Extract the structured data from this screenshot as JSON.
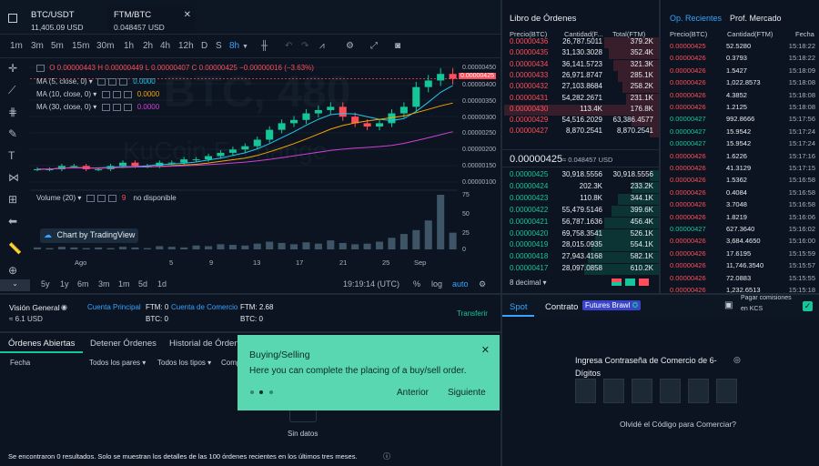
{
  "tabs": [
    {
      "pair": "BTC/USDT",
      "price": "11,405.09 USD"
    },
    {
      "pair": "FTM/BTC",
      "price": "0.048457 USD"
    }
  ],
  "timeframes": [
    "1m",
    "3m",
    "5m",
    "15m",
    "30m",
    "1h",
    "2h",
    "4h",
    "12h",
    "D",
    "S",
    "8h"
  ],
  "ohlc": {
    "o": "O 0.00000443",
    "h": "H 0.00000449",
    "l": "L 0.00000407",
    "c": "C 0.00000425",
    "chg": "−0.00000016 (−3.63%)"
  },
  "ma": [
    {
      "label": "MA (5, close, 0)",
      "value": "0.0000",
      "color": "#23c7ee"
    },
    {
      "label": "MA (10, close, 0)",
      "value": "0.0000",
      "color": "#f7a600"
    },
    {
      "label": "MA (30, close, 0)",
      "value": "0.0000",
      "color": "#d03fd8"
    }
  ],
  "volume": {
    "label": "Volume (20)",
    "value": "9",
    "status": "no disponible"
  },
  "watermark": "BTC, 480",
  "watermark2": "KuCoin Exchange",
  "tradingview": "Chart by TradingView",
  "y_ticks": [
    "0.00000450",
    "0.00000425",
    "0.00000400",
    "0.00000350",
    "0.00000300",
    "0.00000250",
    "0.00000200",
    "0.00000150",
    "0.00000100"
  ],
  "vol_ticks": [
    "75",
    "50",
    "25",
    "0"
  ],
  "x_ticks": [
    "Ago",
    "5",
    "9",
    "13",
    "17",
    "21",
    "25",
    "Sep"
  ],
  "ranges": [
    "5y",
    "1y",
    "6m",
    "3m",
    "1m",
    "5d",
    "1d"
  ],
  "chart_footer": {
    "time": "19:19:14 (UTC)",
    "pct": "%",
    "log": "log",
    "auto": "auto"
  },
  "account": {
    "title": "Visión General",
    "usd": "≈ 6.1 USD",
    "main": "Cuenta Principal",
    "ftm": "FTM: 0",
    "trade_acc": "Cuenta de Comercio",
    "ftm2": "FTM: 2.68",
    "btc": "BTC: 0",
    "btc2": "BTC: 0",
    "transfer": "Transferir"
  },
  "orders_tabs": [
    "Órdenes Abiertas",
    "Detener Órdenes",
    "Historial de Órdenes"
  ],
  "orders_filters": {
    "fecha": "Fecha",
    "pares": "Todos los pares",
    "tipos": "Todos los tipos",
    "comp": "Comp"
  },
  "no_data": "Sin datos",
  "footer_note": "Se encontraron 0 resultados. Solo se muestran los detalles de las 100 órdenes recientes en los últimos tres meses.",
  "orderbook": {
    "title": "Libro de Órdenes",
    "headers": [
      "Precio(BTC)",
      "Cantidad(F...",
      "Total(FTM)"
    ],
    "asks": [
      {
        "p": "0.00000436",
        "q": "26,787.5011",
        "t": "379.2K",
        "w": 60
      },
      {
        "p": "0.00000435",
        "q": "31,130.3028",
        "t": "352.4K",
        "w": 55
      },
      {
        "p": "0.00000434",
        "q": "36,141.5723",
        "t": "321.3K",
        "w": 50
      },
      {
        "p": "0.00000433",
        "q": "26,971.8747",
        "t": "285.1K",
        "w": 45
      },
      {
        "p": "0.00000432",
        "q": "27,103.8684",
        "t": "258.2K",
        "w": 40
      },
      {
        "p": "0.00000431",
        "q": "54,282.2671",
        "t": "231.1K",
        "w": 36
      },
      {
        "p": "0.00000430",
        "q": "113.4K",
        "t": "176.8K",
        "w": 170
      },
      {
        "p": "0.00000429",
        "q": "54,516.2029",
        "t": "63,386.4577",
        "w": 30
      },
      {
        "p": "0.00000427",
        "q": "8,870.2541",
        "t": "8,870.2541",
        "w": 10
      }
    ],
    "last": "0.00000425",
    "last_usd": "≈ 0.048457 USD",
    "bids": [
      {
        "p": "0.00000425",
        "q": "30,918.5556",
        "t": "30,918.5556",
        "w": 10
      },
      {
        "p": "0.00000424",
        "q": "202.3K",
        "t": "233.2K",
        "w": 30
      },
      {
        "p": "0.00000423",
        "q": "110.8K",
        "t": "344.1K",
        "w": 45
      },
      {
        "p": "0.00000422",
        "q": "55,479.5146",
        "t": "399.6K",
        "w": 52
      },
      {
        "p": "0.00000421",
        "q": "56,787.1636",
        "t": "456.4K",
        "w": 60
      },
      {
        "p": "0.00000420",
        "q": "69,758.3541",
        "t": "526.1K",
        "w": 70
      },
      {
        "p": "0.00000419",
        "q": "28,015.0935",
        "t": "554.1K",
        "w": 74
      },
      {
        "p": "0.00000418",
        "q": "27,943.4168",
        "t": "582.1K",
        "w": 78
      },
      {
        "p": "0.00000417",
        "q": "28,097.0858",
        "t": "610.2K",
        "w": 82
      }
    ],
    "decimal": "8 decimal"
  },
  "trades": {
    "tab1": "Op. Recientes",
    "tab2": "Prof. Mercado",
    "headers": [
      "Precio(BTC)",
      "Cantidad(FTM)",
      "Fecha"
    ],
    "rows": [
      {
        "p": "0.00000425",
        "q": "52.5280",
        "t": "15:18:22",
        "c": "red"
      },
      {
        "p": "0.00000426",
        "q": "0.3793",
        "t": "15:18:22",
        "c": "red"
      },
      {
        "p": "0.00000426",
        "q": "1.5427",
        "t": "15:18:09",
        "c": "red"
      },
      {
        "p": "0.00000426",
        "q": "1,022.8573",
        "t": "15:18:08",
        "c": "red"
      },
      {
        "p": "0.00000426",
        "q": "4.3852",
        "t": "15:18:08",
        "c": "red"
      },
      {
        "p": "0.00000426",
        "q": "1.2125",
        "t": "15:18:08",
        "c": "red"
      },
      {
        "p": "0.00000427",
        "q": "992.8666",
        "t": "15:17:56",
        "c": "green"
      },
      {
        "p": "0.00000427",
        "q": "15.9542",
        "t": "15:17:24",
        "c": "green"
      },
      {
        "p": "0.00000427",
        "q": "15.9542",
        "t": "15:17:24",
        "c": "green"
      },
      {
        "p": "0.00000426",
        "q": "1.6226",
        "t": "15:17:16",
        "c": "red"
      },
      {
        "p": "0.00000426",
        "q": "41.3129",
        "t": "15:17:15",
        "c": "red"
      },
      {
        "p": "0.00000426",
        "q": "1.5362",
        "t": "15:16:58",
        "c": "red"
      },
      {
        "p": "0.00000426",
        "q": "0.4084",
        "t": "15:16:58",
        "c": "red"
      },
      {
        "p": "0.00000426",
        "q": "3.7048",
        "t": "15:16:58",
        "c": "red"
      },
      {
        "p": "0.00000426",
        "q": "1.8219",
        "t": "15:16:06",
        "c": "red"
      },
      {
        "p": "0.00000427",
        "q": "627.3640",
        "t": "15:16:02",
        "c": "green"
      },
      {
        "p": "0.00000426",
        "q": "3,684.4650",
        "t": "15:16:00",
        "c": "red"
      },
      {
        "p": "0.00000426",
        "q": "17.6195",
        "t": "15:15:59",
        "c": "red"
      },
      {
        "p": "0.00000426",
        "q": "11,746.3540",
        "t": "15:15:57",
        "c": "red"
      },
      {
        "p": "0.00000426",
        "q": "72.0883",
        "t": "15:15:55",
        "c": "red"
      },
      {
        "p": "0.00000426",
        "q": "1,232.6513",
        "t": "15:15:18",
        "c": "red"
      }
    ]
  },
  "trade_panel": {
    "spot": "Spot",
    "contract": "Contrato",
    "badge": "Futures Brawl",
    "fees": "Pagar comisiones en KCS",
    "pass_title": "Ingresa Contraseña de Comercio de 6-Dígitos",
    "forgot": "Olvidé el Código para Comerciar?"
  },
  "tooltip": {
    "title": "Buying/Selling",
    "body": "Here you can complete the placing of a buy/sell order.",
    "prev": "Anterior",
    "next": "Siguiente"
  },
  "colors": {
    "up": "#15c798",
    "down": "#ff4d5a",
    "accent": "#36a3ff",
    "tooltip": "#59d7b0"
  },
  "chart_data": {
    "type": "candlestick",
    "x": [
      "Ago",
      "5",
      "9",
      "13",
      "17",
      "21",
      "25",
      "Sep"
    ],
    "ylim": [
      1e-06,
      4.6e-06
    ],
    "close_series": [
      1.5e-06,
      1.5e-06,
      1.6e-06,
      1.6e-06,
      1.5e-06,
      1.5e-06,
      1.6e-06,
      1.7e-06,
      1.6e-06,
      1.6e-06,
      1.7e-06,
      1.7e-06,
      1.8e-06,
      1.8e-06,
      1.9e-06,
      2e-06,
      2.1e-06,
      2.2e-06,
      2.4e-06,
      2.7e-06,
      2.9e-06,
      3e-06,
      3.2e-06,
      3.3e-06,
      3.4e-06,
      3.1e-06,
      2.9e-06,
      2.8e-06,
      2.9e-06,
      3.2e-06,
      3.4e-06,
      4e-06,
      4.2e-06,
      4.4e-06,
      4.25e-06
    ],
    "volume": [
      3,
      2,
      4,
      3,
      2,
      3,
      2,
      4,
      3,
      2,
      5,
      4,
      3,
      6,
      5,
      8,
      7,
      6,
      9,
      12,
      10,
      8,
      11,
      9,
      14,
      10,
      8,
      9,
      12,
      18,
      24,
      30,
      45,
      85,
      26
    ]
  }
}
